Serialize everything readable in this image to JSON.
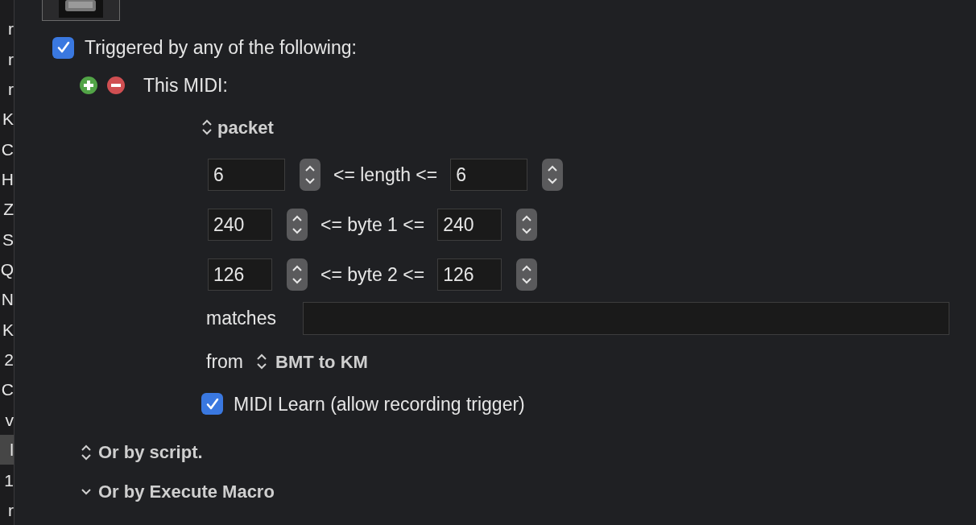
{
  "sidebar": {
    "items": [
      {
        "label": "r",
        "selected": false
      },
      {
        "label": "r",
        "selected": false
      },
      {
        "label": "r",
        "selected": false
      },
      {
        "label": "K",
        "selected": false
      },
      {
        "label": "C",
        "selected": false
      },
      {
        "label": "H",
        "selected": false
      },
      {
        "label": "Z",
        "selected": false
      },
      {
        "label": "S",
        "selected": false
      },
      {
        "label": "Q",
        "selected": false
      },
      {
        "label": "N",
        "selected": false
      },
      {
        "label": "K",
        "selected": false
      },
      {
        "label": "2",
        "selected": false
      },
      {
        "label": "C",
        "selected": false
      },
      {
        "label": "v",
        "selected": false
      },
      {
        "label": "l",
        "selected": true
      },
      {
        "label": "1",
        "selected": false
      },
      {
        "label": "r",
        "selected": false
      }
    ]
  },
  "trigger": {
    "label": "Triggered by any of the following:",
    "checked": true
  },
  "midi": {
    "label": "This MIDI:",
    "type_popup": "packet",
    "ranges": [
      {
        "min": "6",
        "label": "<= length <=",
        "max": "6",
        "kind": "wide"
      },
      {
        "min": "240",
        "label": "<= byte 1 <=",
        "max": "240",
        "kind": "narrow"
      },
      {
        "min": "126",
        "label": "<= byte 2 <=",
        "max": "126",
        "kind": "narrow"
      }
    ],
    "matches_label": "matches",
    "from_label": "from",
    "from_popup": "BMT to KM",
    "learn": {
      "label": "MIDI Learn (allow recording trigger)",
      "checked": true
    }
  },
  "sections": [
    {
      "label": "Or by script.",
      "kind": "popup"
    },
    {
      "label": "Or by Execute Macro",
      "kind": "disclosure"
    }
  ]
}
